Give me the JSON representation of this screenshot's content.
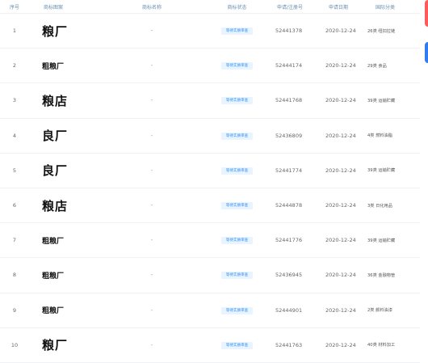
{
  "headers": {
    "no": "序号",
    "trademark": "商标图案",
    "name": "商标名称",
    "status": "商标状态",
    "reg_no": "申请/注册号",
    "date": "申请日期",
    "class": "国际分类"
  },
  "rows": [
    {
      "no": "1",
      "trademark": "粮厂",
      "size": "big",
      "name": "-",
      "status": "等待实质审查",
      "reg_no": "52441378",
      "date": "2020-12-24",
      "class": "26类 纽扣拉链"
    },
    {
      "no": "2",
      "trademark": "粗粮厂",
      "size": "small",
      "name": "-",
      "status": "等待实质审查",
      "reg_no": "52444174",
      "date": "2020-12-24",
      "class": "29类 食品"
    },
    {
      "no": "3",
      "trademark": "粮店",
      "size": "big",
      "name": "-",
      "status": "等待实质审查",
      "reg_no": "52441768",
      "date": "2020-12-24",
      "class": "39类 运输贮藏"
    },
    {
      "no": "4",
      "trademark": "良厂",
      "size": "big",
      "name": "-",
      "status": "等待实质审查",
      "reg_no": "52436809",
      "date": "2020-12-24",
      "class": "4类 燃料油脂"
    },
    {
      "no": "5",
      "trademark": "良厂",
      "size": "big",
      "name": "-",
      "status": "等待实质审查",
      "reg_no": "52441774",
      "date": "2020-12-24",
      "class": "39类 运输贮藏"
    },
    {
      "no": "6",
      "trademark": "粮店",
      "size": "big",
      "name": "-",
      "status": "等待实质审查",
      "reg_no": "52444878",
      "date": "2020-12-24",
      "class": "3类 日化用品"
    },
    {
      "no": "7",
      "trademark": "粗粮厂",
      "size": "small",
      "name": "-",
      "status": "等待实质审查",
      "reg_no": "52441776",
      "date": "2020-12-24",
      "class": "39类 运输贮藏"
    },
    {
      "no": "8",
      "trademark": "粗粮厂",
      "size": "small",
      "name": "-",
      "status": "等待实质审查",
      "reg_no": "52436945",
      "date": "2020-12-24",
      "class": "36类 金融物管"
    },
    {
      "no": "9",
      "trademark": "粗粮厂",
      "size": "small",
      "name": "-",
      "status": "等待实质审查",
      "reg_no": "52444901",
      "date": "2020-12-24",
      "class": "2类 颜料油漆"
    },
    {
      "no": "10",
      "trademark": "粮厂",
      "size": "big",
      "name": "-",
      "status": "等待实质审查",
      "reg_no": "52441763",
      "date": "2020-12-24",
      "class": "40类 材料加工"
    }
  ]
}
